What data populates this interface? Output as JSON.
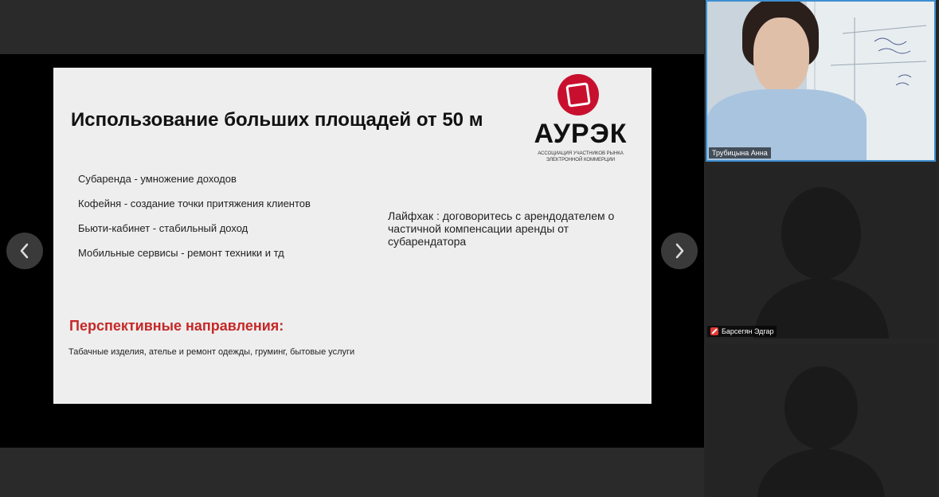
{
  "slide": {
    "title": "Использование больших площадей от 50 м",
    "bullets": [
      "Субаренда - умножение доходов",
      "Кофейня - создание точки притяжения клиентов",
      "Бьюти-кабинет - стабильный доход",
      "Мобильные сервисы - ремонт техники и тд"
    ],
    "lifehack": "Лайфхак : договоритесь с арендодателем о частичной компенсации аренды от субарендатора",
    "perspective_title": "Перспективные направления:",
    "perspective_text": "Табачные изделия, ателье и ремонт одежды, груминг, бытовые услуги",
    "logo": {
      "name": "АУРЭК",
      "subtitle": "АССОЦИАЦИЯ УЧАСТНИКОВ РЫНКА ЭЛЕКТРОННОЙ КОММЕРЦИИ",
      "color": "#c8102e"
    }
  },
  "navigation": {
    "prev_icon": "chevron-left-icon",
    "next_icon": "chevron-right-icon"
  },
  "participants": [
    {
      "name": "Трубицына Анна",
      "active_speaker": true,
      "muted": false
    },
    {
      "name": "Барсегян Эдгар",
      "active_speaker": false,
      "muted": true
    },
    {
      "name": "",
      "active_speaker": false,
      "muted": false
    }
  ],
  "colors": {
    "active_speaker_border": "#3e8ed0",
    "accent_red": "#c62828",
    "muted_icon": "#e53935"
  }
}
